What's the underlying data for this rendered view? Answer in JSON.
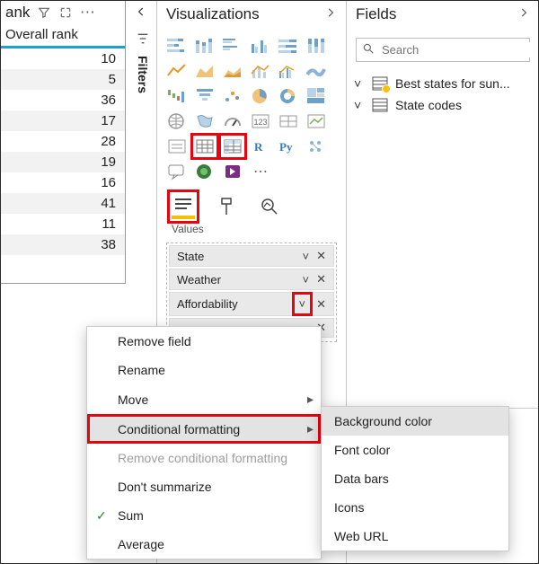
{
  "table": {
    "title_partial": "ank",
    "column_header": "Overall rank",
    "rows": [
      10,
      5,
      36,
      17,
      28,
      19,
      16,
      41,
      11,
      38
    ]
  },
  "filters_tab": {
    "label": "Filters"
  },
  "visualizations": {
    "title": "Visualizations",
    "tools_section_label": "Values"
  },
  "wells": {
    "items": [
      {
        "label": "State"
      },
      {
        "label": "Weather"
      },
      {
        "label": "Affordability"
      }
    ]
  },
  "context_menu": {
    "items": [
      {
        "label": "Remove field"
      },
      {
        "label": "Rename"
      },
      {
        "label": "Move",
        "submenu": true
      },
      {
        "label": "Conditional formatting",
        "submenu": true,
        "highlight": true,
        "hover": true
      },
      {
        "label": "Remove conditional formatting",
        "disabled": true
      },
      {
        "label": "Don't summarize"
      },
      {
        "label": "Sum",
        "checked": true
      },
      {
        "label": "Average"
      }
    ]
  },
  "submenu": {
    "items": [
      {
        "label": "Background color",
        "hover": true
      },
      {
        "label": "Font color"
      },
      {
        "label": "Data bars"
      },
      {
        "label": "Icons"
      },
      {
        "label": "Web URL"
      }
    ]
  },
  "fields": {
    "title": "Fields",
    "search_placeholder": "Search",
    "tables": [
      {
        "label": "Best states for sun...",
        "warn": true
      },
      {
        "label": "State codes",
        "warn": false
      }
    ]
  }
}
